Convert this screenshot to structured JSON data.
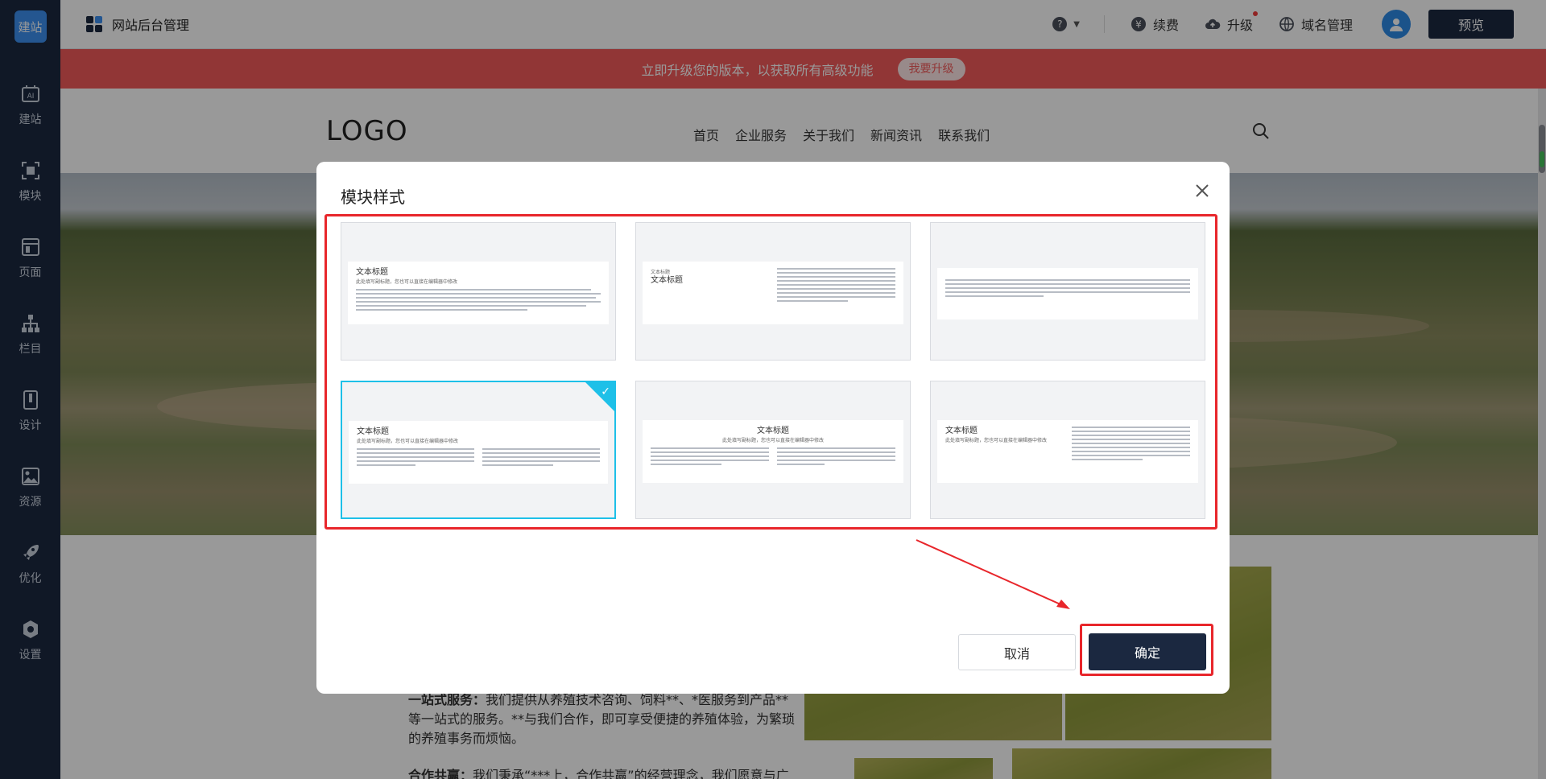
{
  "brand": "建站",
  "sidebar": {
    "items": [
      {
        "label": "建站",
        "icon": "ai-build-icon"
      },
      {
        "label": "模块",
        "icon": "module-icon"
      },
      {
        "label": "页面",
        "icon": "page-icon"
      },
      {
        "label": "栏目",
        "icon": "column-tree-icon"
      },
      {
        "label": "设计",
        "icon": "design-icon"
      },
      {
        "label": "资源",
        "icon": "resource-image-icon"
      },
      {
        "label": "优化",
        "icon": "rocket-icon"
      },
      {
        "label": "设置",
        "icon": "settings-icon"
      }
    ]
  },
  "header": {
    "title": "网站后台管理",
    "help": "?",
    "renew": "续费",
    "upgrade": "升级",
    "domain": "域名管理",
    "preview": "预览"
  },
  "banner": {
    "text": "立即升级您的版本，以获取所有高级功能",
    "button": "我要升级"
  },
  "site": {
    "logo": "LOGO",
    "nav": [
      "首页",
      "企业服务",
      "关于我们",
      "新闻资讯",
      "联系我们"
    ],
    "paragraph1_bold": "一站式服务：",
    "paragraph1": "我们提供从养殖技术咨询、饲料**、*医服务到产品**等一站式的服务。**与我们合作，即可享受便捷的养殖体验，为繁琐的养殖事务而烦恼。",
    "paragraph2_bold": "合作共赢：",
    "paragraph2": "我们秉承“***上，合作共赢”的经营理念，我们愿意与广"
  },
  "modal": {
    "title": "模块样式",
    "cards": [
      {
        "head": "文本标题",
        "sub": "此处填写副标题，您也可以直接在编辑器中修改",
        "layout": "single"
      },
      {
        "head": "文本标题",
        "sub": "文本标题",
        "layout": "split"
      },
      {
        "head": "",
        "sub": "",
        "layout": "text-only"
      },
      {
        "head": "文本标题",
        "sub": "此处填写副标题，您也可以直接在编辑器中修改",
        "layout": "two-col",
        "selected": true
      },
      {
        "head": "文本标题",
        "sub": "此处填写副标题，您也可以直接在编辑器中修改",
        "layout": "centered-two-col"
      },
      {
        "head": "文本标题",
        "sub": "此处填写副标题，您也可以直接在编辑器中修改",
        "layout": "split"
      }
    ],
    "cancel": "取消",
    "confirm": "确定"
  },
  "colors": {
    "sidebar": "#1b2840",
    "accent": "#1ec0e8",
    "banner": "#f25a5a",
    "annotation": "#e8262b"
  }
}
